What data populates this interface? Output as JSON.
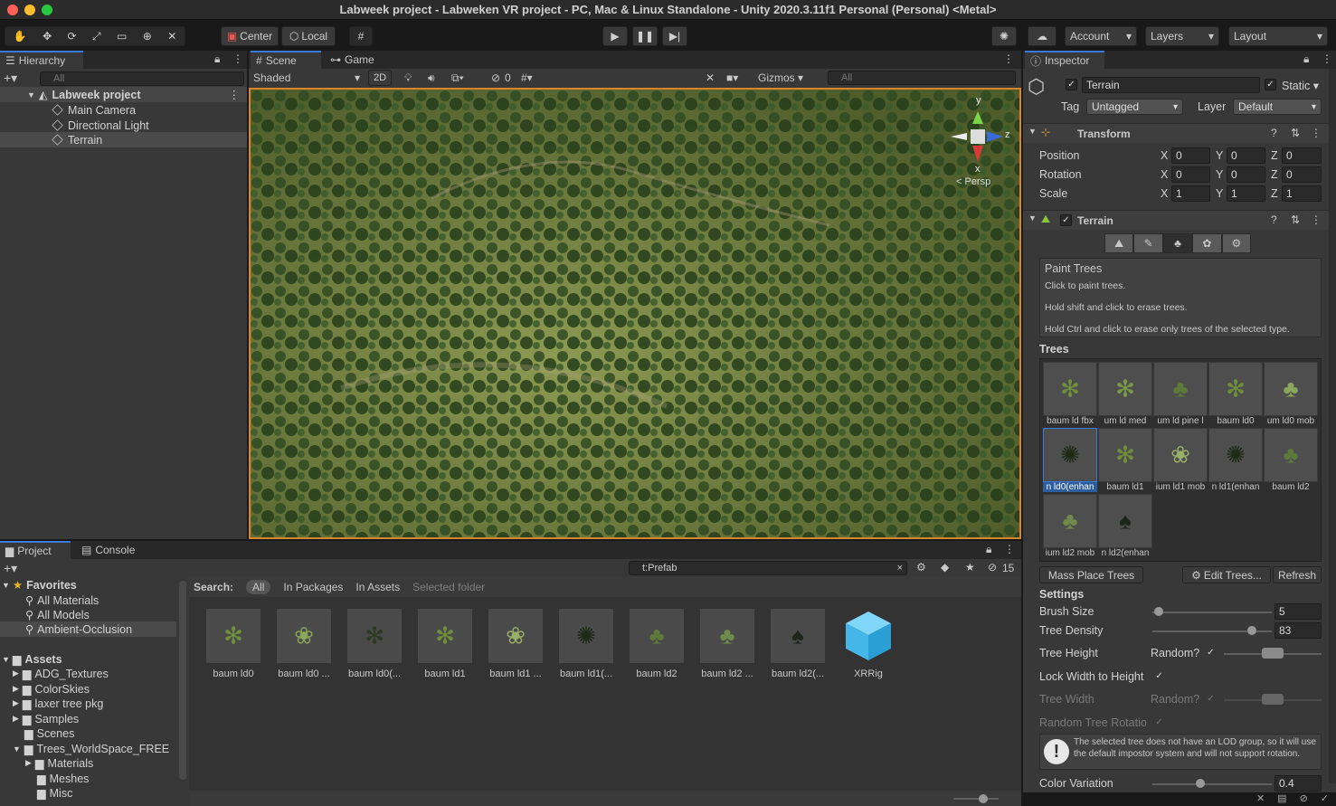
{
  "window": {
    "title": "Labweek project - Labweken VR project - PC, Mac & Linux Standalone - Unity 2020.3.11f1 Personal (Personal) <Metal>"
  },
  "toolbar": {
    "pivot_label": "Center",
    "space_label": "Local",
    "account_label": "Account",
    "layers_label": "Layers",
    "layout_label": "Layout"
  },
  "hierarchy": {
    "tab_label": "Hierarchy",
    "search_placeholder": "All",
    "scene_name": "Labweek project",
    "items": [
      {
        "label": "Main Camera"
      },
      {
        "label": "Directional Light"
      },
      {
        "label": "Terrain"
      }
    ]
  },
  "scene": {
    "tab_scene": "Scene",
    "tab_game": "Game",
    "shading_mode": "Shaded",
    "mode_2d": "2D",
    "hidden_count": "0",
    "gizmos_label": "Gizmos",
    "search_placeholder": "All",
    "gizmo_y": "y",
    "gizmo_z": "z",
    "gizmo_x": "x",
    "persp_label": "< Persp"
  },
  "project": {
    "tab_project": "Project",
    "tab_console": "Console",
    "search_value": "t:Prefab",
    "hidden_count": "15",
    "favorites_label": "Favorites",
    "favorites": [
      {
        "label": "All Materials"
      },
      {
        "label": "All Models"
      },
      {
        "label": "Ambient-Occlusion"
      }
    ],
    "assets_label": "Assets",
    "folders": [
      {
        "label": "ADG_Textures"
      },
      {
        "label": "ColorSkies"
      },
      {
        "label": "laxer tree pkg"
      },
      {
        "label": "Samples"
      },
      {
        "label": "Scenes"
      },
      {
        "label": "Trees_WorldSpace_FREE"
      },
      {
        "label": "Materials"
      },
      {
        "label": "Meshes"
      },
      {
        "label": "Misc"
      }
    ],
    "search_label": "Search:",
    "scope_all": "All",
    "scope_packages": "In Packages",
    "scope_assets": "In Assets",
    "scope_selected": "Selected folder",
    "assets": [
      {
        "label": "baum ld0"
      },
      {
        "label": "baum ld0 ..."
      },
      {
        "label": "baum ld0(..."
      },
      {
        "label": "baum ld1"
      },
      {
        "label": "baum ld1 ..."
      },
      {
        "label": "baum ld1(..."
      },
      {
        "label": "baum ld2"
      },
      {
        "label": "baum ld2 ..."
      },
      {
        "label": "baum ld2(..."
      },
      {
        "label": "XRRig"
      }
    ]
  },
  "inspector": {
    "tab_label": "Inspector",
    "object_name": "Terrain",
    "static_label": "Static",
    "tag_label": "Tag",
    "tag_value": "Untagged",
    "layer_label": "Layer",
    "layer_value": "Default",
    "transform": {
      "title": "Transform",
      "position_label": "Position",
      "rotation_label": "Rotation",
      "scale_label": "Scale",
      "x": "X",
      "y": "Y",
      "z": "Z",
      "position": [
        "0",
        "0",
        "0"
      ],
      "rotation": [
        "0",
        "0",
        "0"
      ],
      "scale": [
        "1",
        "1",
        "1"
      ]
    },
    "terrain": {
      "title": "Terrain",
      "paint_title": "Paint Trees",
      "help1": "Click to paint trees.",
      "help2": "Hold shift and click to erase trees.",
      "help3": "Hold Ctrl and click to erase only trees of the selected type.",
      "trees_label": "Trees",
      "trees": [
        {
          "label": "baum ld fbx"
        },
        {
          "label": "um ld med"
        },
        {
          "label": "um ld pine l"
        },
        {
          "label": "baum ld0"
        },
        {
          "label": "um ld0 mob"
        },
        {
          "label": "n ld0(enhan"
        },
        {
          "label": "baum ld1"
        },
        {
          "label": "ium ld1 mob"
        },
        {
          "label": "n ld1(enhan"
        },
        {
          "label": "baum ld2"
        },
        {
          "label": "ium ld2 mob"
        },
        {
          "label": "n ld2(enhan"
        }
      ],
      "mass_place": "Mass Place Trees",
      "edit_trees": "Edit Trees...",
      "refresh": "Refresh",
      "settings_label": "Settings",
      "brush_size_label": "Brush Size",
      "brush_size_value": "5",
      "brush_size_fraction": 0.05,
      "density_label": "Tree Density",
      "density_value": "83",
      "density_fraction": 0.83,
      "height_label": "Tree Height",
      "random_label": "Random?",
      "lock_label": "Lock Width to Height",
      "width_label": "Tree Width",
      "rotation_label": "Random Tree Rotatio",
      "lod_warning": "The selected tree does not have an LOD group, so it will use the default impostor system and will not support rotation.",
      "color_variation_label": "Color Variation",
      "color_variation_value": "0.4",
      "color_variation_fraction": 0.4
    }
  },
  "colors": {
    "accent": "#3a7ad9",
    "scene_border": "#d9862a"
  }
}
